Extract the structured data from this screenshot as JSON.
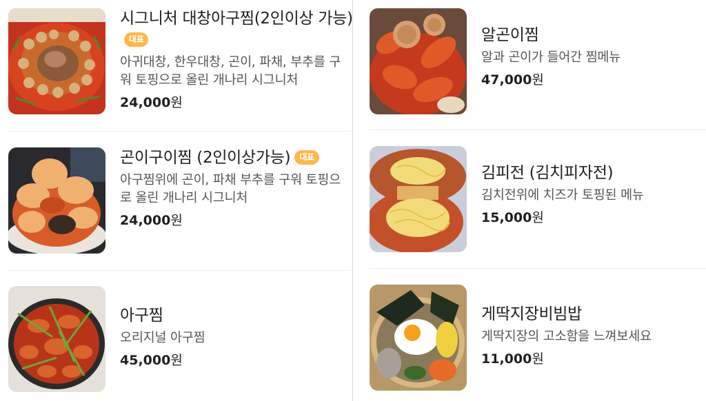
{
  "badge_label": "대표",
  "colors": {
    "badge": "#ffb74d",
    "divider": "#d6d6d6",
    "name_text": "#1f1f1f",
    "desc_text": "#555555"
  },
  "menu_left": [
    {
      "name": "시그니처 대창아구찜(2인이상 가능)",
      "badge": true,
      "description": "아귀대창, 한우대창, 곤이, 파채, 부추를 구워 토핑으로 올린 개나리 시그니처",
      "price_number": "24,000",
      "price_unit": "원",
      "icon": "braised-monkfish-intestine-photo"
    },
    {
      "name": "곤이구이찜 (2인이상가능)",
      "badge": true,
      "description": "아구찜위에 곤이, 파채 부추를 구워 토핑으로 올린 개나리 시그니처",
      "price_number": "24,000",
      "price_unit": "원",
      "icon": "grilled-roe-braise-photo"
    },
    {
      "name": "아구찜",
      "badge": false,
      "description": "오리지널 아구찜",
      "price_number": "45,000",
      "price_unit": "원",
      "icon": "braised-monkfish-photo"
    }
  ],
  "menu_right": [
    {
      "name": "알곤이찜",
      "badge": false,
      "description": "알과 곤이가 들어간 찜메뉴",
      "price_number": "47,000",
      "price_unit": "원",
      "icon": "roe-braise-photo"
    },
    {
      "name": "김피전 (김치피자전)",
      "badge": false,
      "description": "김치전위에 치즈가 토핑된 메뉴",
      "price_number": "15,000",
      "price_unit": "원",
      "icon": "kimchi-pizza-pancake-photo"
    },
    {
      "name": "게딱지장비빔밥",
      "badge": false,
      "description": "게딱지장의 고소함을 느껴보세요",
      "price_number": "11,000",
      "price_unit": "원",
      "icon": "crab-shell-bibimbap-photo"
    }
  ]
}
